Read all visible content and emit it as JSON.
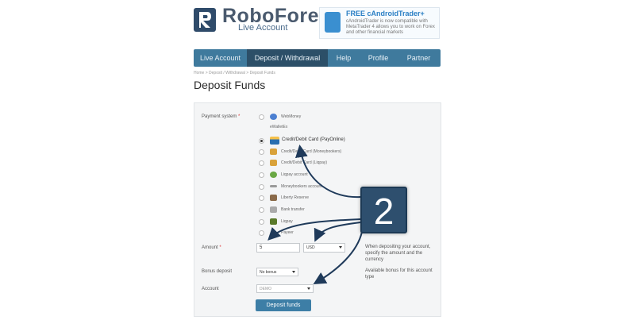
{
  "header": {
    "brand": "RoboForex",
    "subtitle": "Live Account",
    "ad_title": "FREE cAndroidTrader+",
    "ad_text": "cAndroidTrader is now compatible with MetaTrader 4 allows you to work on Forex and other financial markets"
  },
  "nav": {
    "items": [
      "Live Account",
      "Deposit / Withdrawal",
      "Help",
      "Profile",
      "Partner"
    ],
    "active_index": 1
  },
  "breadcrumb": "Home > Deposit / Withdrawal > Deposit Funds",
  "page_title": "Deposit Funds",
  "form": {
    "payment_label": "Payment system",
    "payment_options": [
      {
        "label": "WebMoney",
        "icon": "webmoney-icon",
        "color": "#4b7fd1"
      },
      {
        "label": "eWalletEx",
        "icon": "none",
        "color": "#ffffff"
      },
      {
        "label": "Credit/Debit Card (PayOnline)",
        "icon": "credit-card-icon",
        "color": "#2a6fb0"
      },
      {
        "label": "Credit/Debit Card (Moneybookers)",
        "icon": "card-icon",
        "color": "#d9a23a"
      },
      {
        "label": "Credit/Debit Card (Liqpay)",
        "icon": "card-icon",
        "color": "#d9a23a"
      },
      {
        "label": "Liqpay account",
        "icon": "liqpay-icon",
        "color": "#6aa844"
      },
      {
        "label": "Moneybookers account",
        "icon": "moneybookers-icon",
        "color": "#9a9a9a"
      },
      {
        "label": "Liberty Reserve",
        "icon": "liberty-icon",
        "color": "#8a6a4a"
      },
      {
        "label": "Bank transfer",
        "icon": "bank-icon",
        "color": "#aaaaaa"
      },
      {
        "label": "Liqpay",
        "icon": "liqpay-icon",
        "color": "#5a7a2a"
      },
      {
        "label": "Payeer",
        "icon": "none",
        "color": "#ffffff"
      }
    ],
    "selected_index": 2,
    "amount_label": "Amount",
    "amount_value": "5",
    "currency_value": "USD",
    "amount_hint": "When depositing your account, specify the amount and the currency",
    "bonus_label": "Bonus deposit",
    "bonus_value": "No bonus",
    "bonus_hint": "Available bonus for this account type",
    "account_label": "Account",
    "account_value": "DEMO",
    "submit_label": "Deposit funds"
  },
  "overlay": {
    "step_number": "2",
    "arrow_color": "#1f3a5a"
  }
}
